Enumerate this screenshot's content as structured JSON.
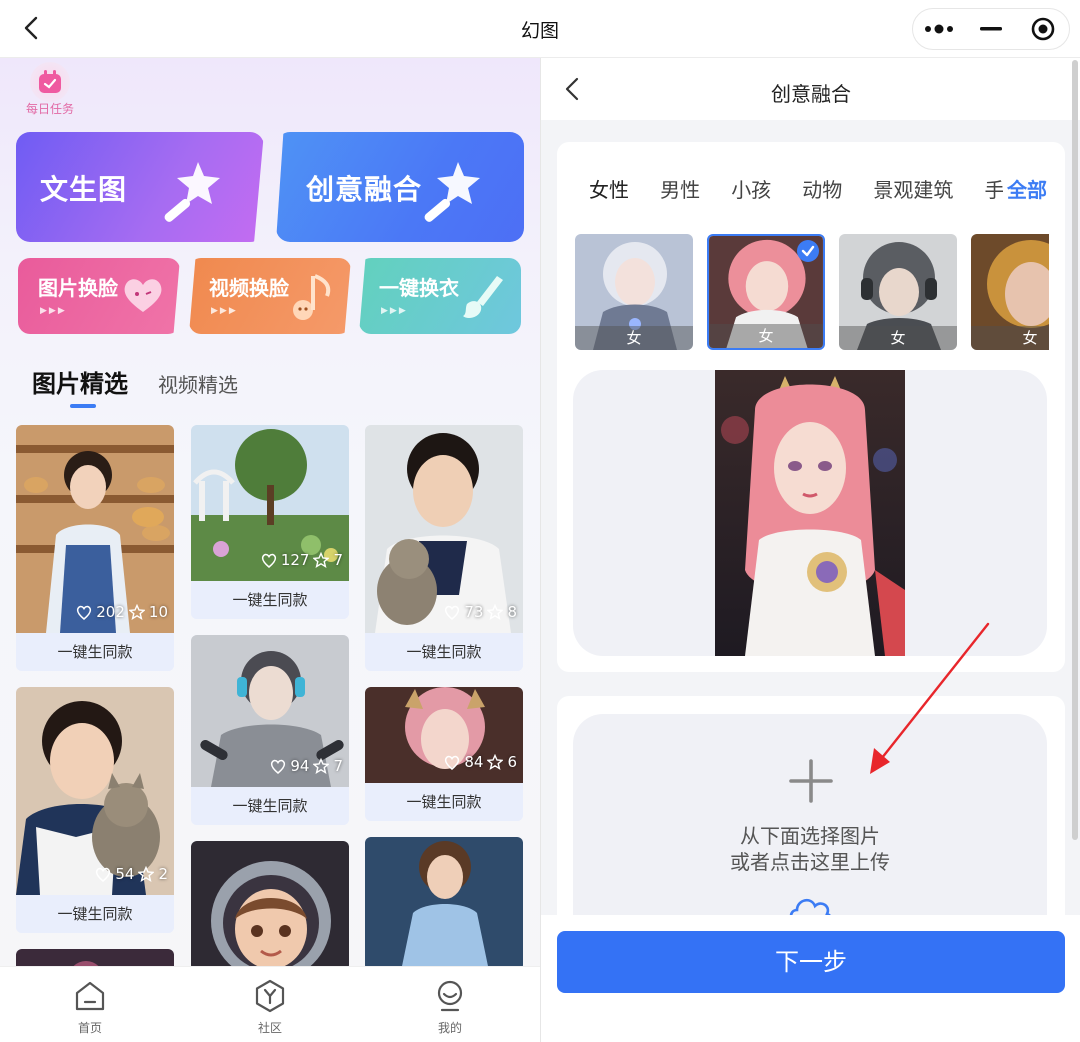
{
  "window": {
    "title": "幻图"
  },
  "left": {
    "daily_task": "每日任务",
    "big_cards": [
      "文生图",
      "创意融合"
    ],
    "small_cards": [
      "图片换脸",
      "视频换脸",
      "一键换衣"
    ],
    "feed_tabs": [
      "图片精选",
      "视频精选"
    ],
    "action_label": "一键生同款",
    "gallery": [
      {
        "likes": "202",
        "stars": "10"
      },
      {
        "likes": "127",
        "stars": "7"
      },
      {
        "likes": "73",
        "stars": "8"
      },
      {
        "likes": "54",
        "stars": "2"
      },
      {
        "likes": "94",
        "stars": "7"
      },
      {
        "likes": "84",
        "stars": "6"
      }
    ],
    "nav": [
      "首页",
      "社区",
      "我的"
    ]
  },
  "right": {
    "title": "创意融合",
    "category_tabs": [
      "女性",
      "男性",
      "小孩",
      "动物",
      "景观建筑",
      "手"
    ],
    "category_all": "全部",
    "thumb_caption": "女",
    "upload_line1": "从下面选择图片",
    "upload_line2": "或者点击这里上传",
    "next_button": "下一步"
  },
  "colors": {
    "accent": "#3472f5",
    "tab_indicator": "#3c7cf4"
  }
}
